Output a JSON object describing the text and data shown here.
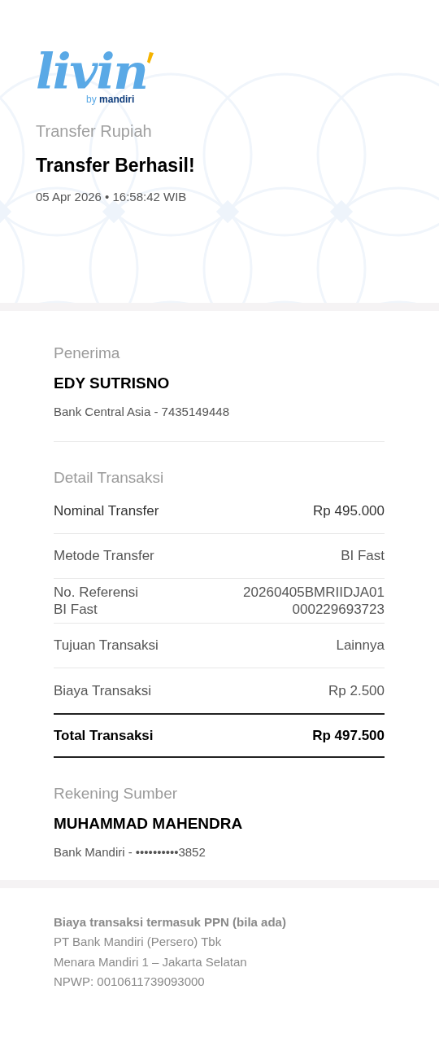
{
  "logo": {
    "wordmark": "livin",
    "byline_prefix": "by",
    "byline_brand": "mandiri"
  },
  "header": {
    "category": "Transfer Rupiah",
    "title": "Transfer Berhasil!",
    "timestamp": "05 Apr 2026 • 16:58:42 WIB"
  },
  "recipient": {
    "heading": "Penerima",
    "name": "EDY SUTRISNO",
    "account": "Bank Central Asia - 7435149448"
  },
  "details": {
    "heading": "Detail Transaksi",
    "rows": [
      {
        "kind": "emphasis",
        "label": "Nominal Transfer",
        "value": "Rp 495.000"
      },
      {
        "kind": "normal",
        "label": "Metode Transfer",
        "value": "BI Fast"
      },
      {
        "kind": "normal",
        "label": "No. Referensi\nBI Fast",
        "value": "20260405BMRIIDJA01\n000229693723"
      },
      {
        "kind": "normal",
        "label": "Tujuan Transaksi",
        "value": "Lainnya"
      },
      {
        "kind": "normal",
        "label": "Biaya Transaksi",
        "value": "Rp 2.500"
      },
      {
        "kind": "total",
        "label": "Total Transaksi",
        "value": "Rp 497.500"
      }
    ]
  },
  "source": {
    "heading": "Rekening Sumber",
    "name": "MUHAMMAD MAHENDRA",
    "account": "Bank Mandiri - ••••••••••3852"
  },
  "footer": {
    "note": "Biaya transaksi termasuk PPN (bila ada)",
    "lines": [
      "PT Bank Mandiri (Persero) Tbk",
      "Menara Mandiri 1 – Jakarta Selatan",
      "NPWP: 0010611739093000"
    ]
  }
}
